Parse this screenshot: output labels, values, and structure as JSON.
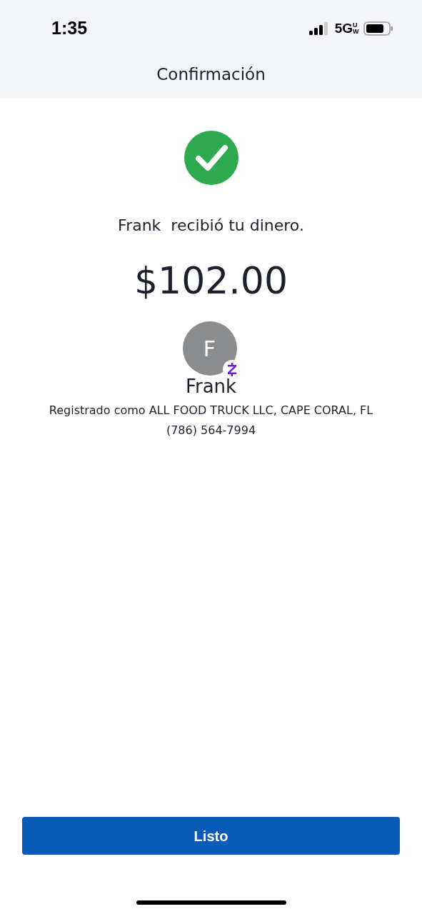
{
  "status_bar": {
    "time": "1:35",
    "network": "5G",
    "network_badge": "UW"
  },
  "nav": {
    "title": "Confirmación"
  },
  "message": "Frank  recibió tu dinero.",
  "amount": "$102.00",
  "recipient": {
    "initial": "F",
    "name": "Frank",
    "registered": "Registrado como ALL FOOD TRUCK LLC, CAPE CORAL, FL",
    "phone": "(786) 564-7994"
  },
  "button": {
    "label": "Listo"
  }
}
